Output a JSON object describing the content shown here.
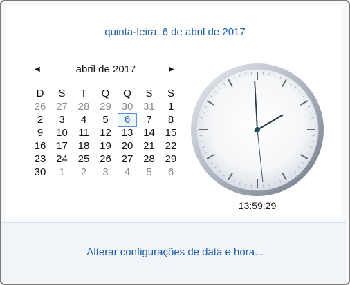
{
  "header": {
    "full_date": "quinta-feira, 6 de abril de 2017"
  },
  "calendar": {
    "month_label": "abril de 2017",
    "prev_icon": "left-triangle-icon",
    "next_icon": "right-triangle-icon",
    "weekdays": [
      "D",
      "S",
      "T",
      "Q",
      "Q",
      "S",
      "S"
    ],
    "weeks": [
      [
        {
          "d": "26",
          "o": true
        },
        {
          "d": "27",
          "o": true
        },
        {
          "d": "28",
          "o": true
        },
        {
          "d": "29",
          "o": true
        },
        {
          "d": "30",
          "o": true
        },
        {
          "d": "31",
          "o": true
        },
        {
          "d": "1",
          "o": false
        }
      ],
      [
        {
          "d": "2",
          "o": false
        },
        {
          "d": "3",
          "o": false
        },
        {
          "d": "4",
          "o": false
        },
        {
          "d": "5",
          "o": false
        },
        {
          "d": "6",
          "o": false,
          "today": true
        },
        {
          "d": "7",
          "o": false
        },
        {
          "d": "8",
          "o": false
        }
      ],
      [
        {
          "d": "9",
          "o": false
        },
        {
          "d": "10",
          "o": false
        },
        {
          "d": "11",
          "o": false
        },
        {
          "d": "12",
          "o": false
        },
        {
          "d": "13",
          "o": false
        },
        {
          "d": "14",
          "o": false
        },
        {
          "d": "15",
          "o": false
        }
      ],
      [
        {
          "d": "16",
          "o": false
        },
        {
          "d": "17",
          "o": false
        },
        {
          "d": "18",
          "o": false
        },
        {
          "d": "19",
          "o": false
        },
        {
          "d": "20",
          "o": false
        },
        {
          "d": "21",
          "o": false
        },
        {
          "d": "22",
          "o": false
        }
      ],
      [
        {
          "d": "23",
          "o": false
        },
        {
          "d": "24",
          "o": false
        },
        {
          "d": "25",
          "o": false
        },
        {
          "d": "26",
          "o": false
        },
        {
          "d": "27",
          "o": false
        },
        {
          "d": "28",
          "o": false
        },
        {
          "d": "29",
          "o": false
        }
      ],
      [
        {
          "d": "30",
          "o": false
        },
        {
          "d": "1",
          "o": true
        },
        {
          "d": "2",
          "o": true
        },
        {
          "d": "3",
          "o": true
        },
        {
          "d": "4",
          "o": true
        },
        {
          "d": "5",
          "o": true
        },
        {
          "d": "6",
          "o": true
        }
      ]
    ],
    "other_month_color": "#8c8c8c",
    "today_border_color": "#5a8fd4"
  },
  "clock": {
    "time_text": "13:59:29",
    "hours": 13,
    "minutes": 59,
    "seconds": 29
  },
  "footer": {
    "link_label": "Alterar configurações de data e hora..."
  },
  "colors": {
    "link_blue": "#1e5ea8",
    "panel_bg": "#f1f4f9"
  }
}
